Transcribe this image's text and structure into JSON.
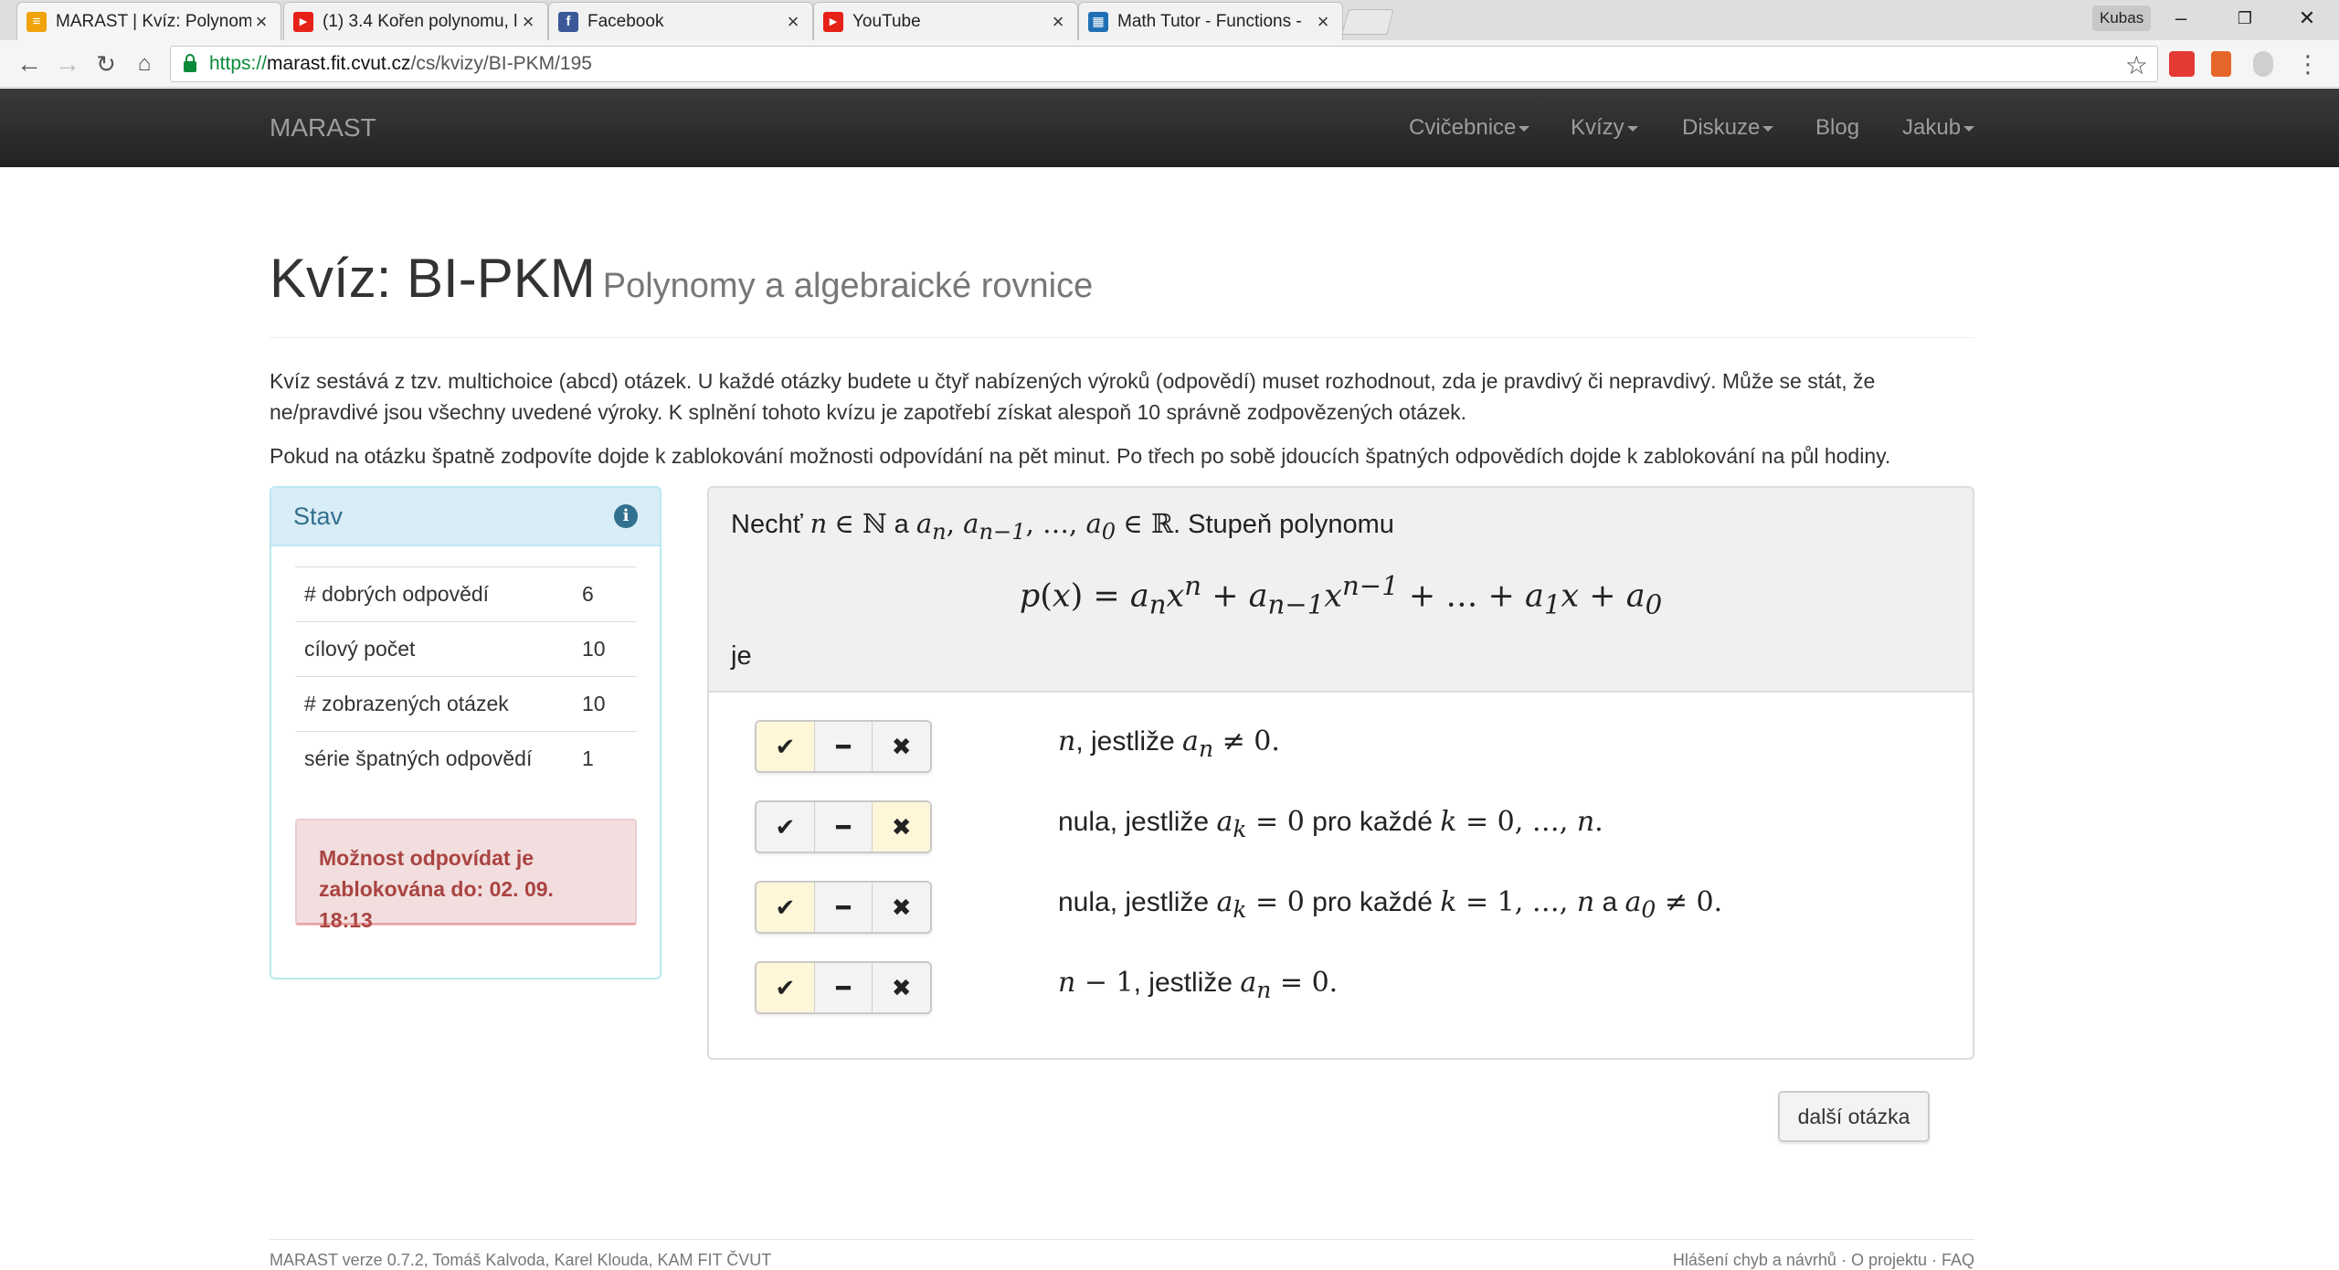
{
  "browser": {
    "tabs": [
      {
        "title": "MARAST | Kvíz: Polynomy",
        "favicon": "marast-icon",
        "color": "#f0a30a",
        "glyph": "≡"
      },
      {
        "title": "(1) 3.4 Kořen polynomu, l",
        "favicon": "youtube-icon",
        "color": "#e62117",
        "glyph": "▶"
      },
      {
        "title": "Facebook",
        "favicon": "facebook-icon",
        "color": "#3b5998",
        "glyph": "f"
      },
      {
        "title": "YouTube",
        "favicon": "youtube-icon",
        "color": "#e62117",
        "glyph": "▶"
      },
      {
        "title": "Math Tutor - Functions -",
        "favicon": "math-tutor-icon",
        "color": "#1f6fb5",
        "glyph": "▦"
      }
    ],
    "profile": "Kubas",
    "url_scheme": "https://",
    "url_host": "marast.fit.cvut.cz",
    "url_path": "/cs/kvizy/BI-PKM/195"
  },
  "site": {
    "brand": "MARAST",
    "nav": [
      "Cvičebnice",
      "Kvízy",
      "Diskuze",
      "Blog",
      "Jakub"
    ]
  },
  "page": {
    "title": "Kvíz: BI-PKM",
    "subtitle": "Polynomy a algebraické rovnice",
    "intro1": "Kvíz sestává z tzv. multichoice (abcd) otázek. U každé otázky budete u čtyř nabízených výroků (odpovědí) muset rozhodnout, zda je pravdivý či nepravdivý. Může se stát, že ne/pravdivé jsou všechny uvedené výroky. K splnění tohoto kvízu je zapotřebí získat alespoň 10 správně zodpovězených otázek.",
    "intro2": "Pokud na otázku špatně zodpovíte dojde k zablokování možnosti odpovídání na pět minut. Po třech po sobě jdoucích špatných odpovědích dojde k zablokování na půl hodiny."
  },
  "stav": {
    "title": "Stav",
    "rows": [
      {
        "label": "# dobrých odpovědí",
        "value": "6"
      },
      {
        "label": "cílový počet",
        "value": "10"
      },
      {
        "label": "# zobrazených otázek",
        "value": "10"
      },
      {
        "label": "série špatných odpovědí",
        "value": "1"
      }
    ],
    "alert": "Možnost odpovídat je zablokována do: 02. 09. 18:13"
  },
  "question": {
    "necht": "Nechť",
    "a": "a",
    "stupen": ". Stupeň polynomu",
    "je": "je",
    "answers": [
      {
        "selected": "true",
        "t1": ", jestliže ",
        "t2": "",
        "t3": ""
      },
      {
        "selected": "false",
        "t1": "nula, jestliže ",
        "t2": " pro každé ",
        "t3": ""
      },
      {
        "selected": "true",
        "t1": "nula, jestliže ",
        "t2": " pro každé ",
        "t3": " a "
      },
      {
        "selected": "true",
        "t1": ", jestliže ",
        "t2": "",
        "t3": ""
      }
    ]
  },
  "next_button": "další otázka",
  "footer": {
    "left": "MARAST verze 0.7.2, Tomáš Kalvoda, Karel Klouda, KAM FIT ČVUT",
    "right": "Hlášení chyb a návrhů · O projektu · FAQ"
  }
}
